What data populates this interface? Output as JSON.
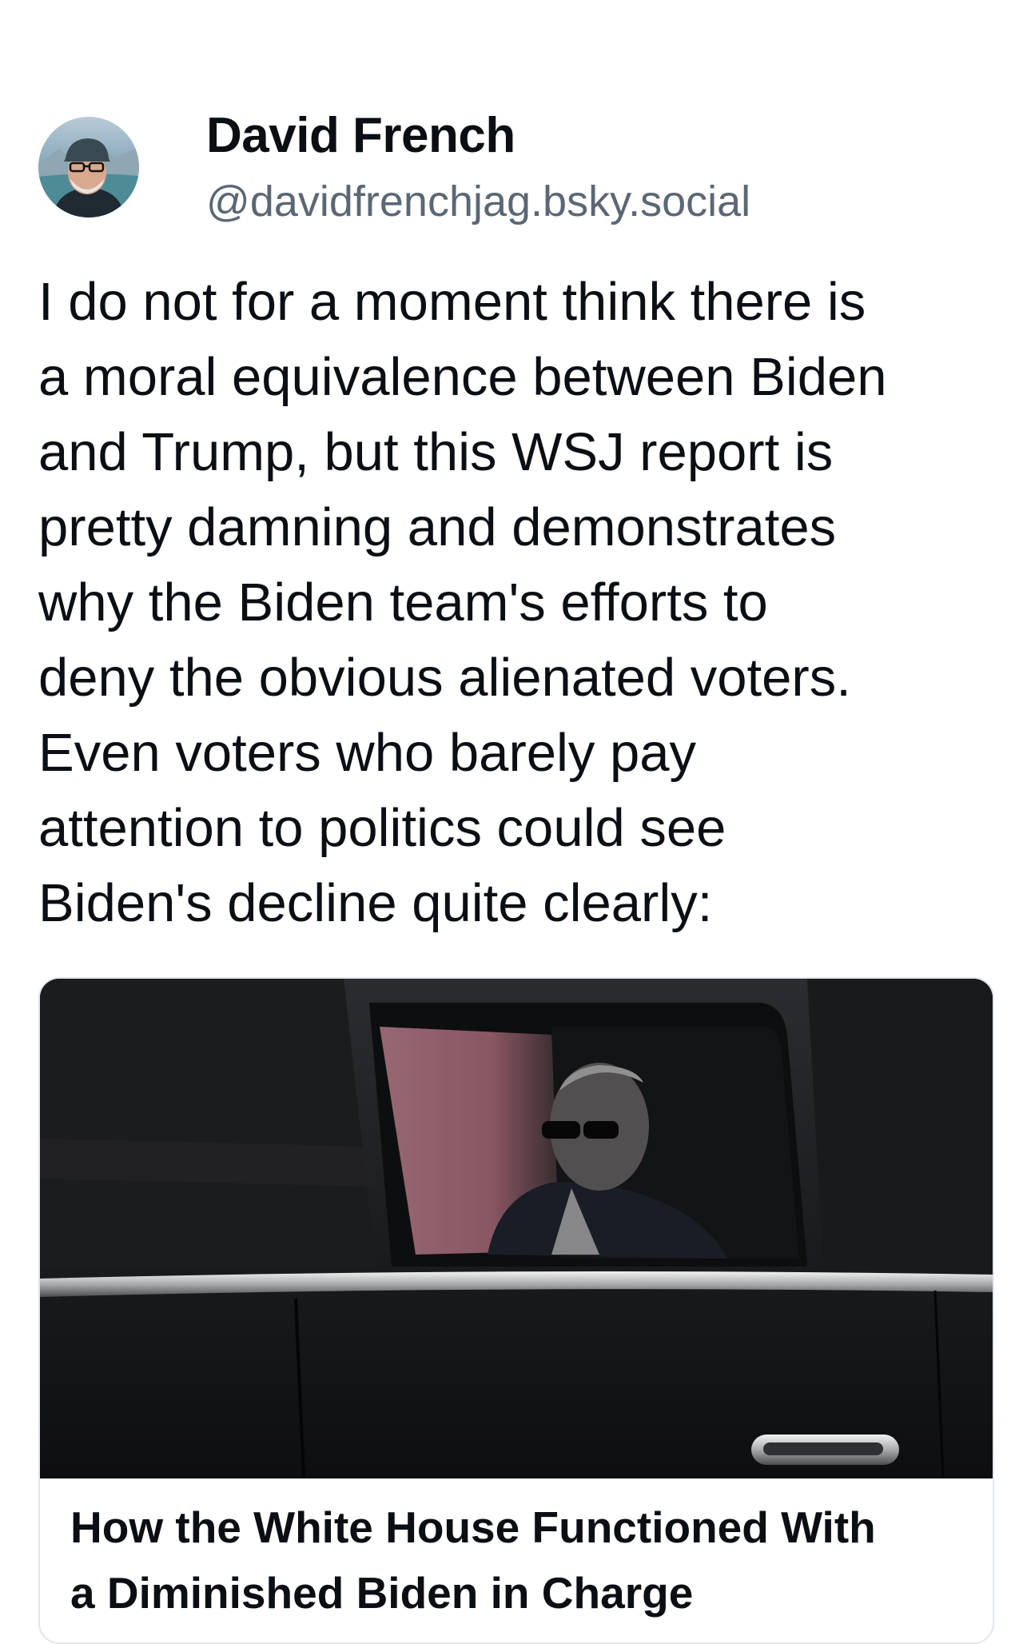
{
  "author": {
    "display_name": "David French",
    "handle": "@davidfrenchjag.bsky.social",
    "avatar_icon": "avatar-photo"
  },
  "post": {
    "text_lines": [
      "I do not for a moment think there is",
      "a moral equivalence between Biden",
      "and Trump, but this WSJ report is",
      "pretty damning and demonstrates",
      "why the Biden team's efforts to",
      "deny the obvious alienated voters.",
      "Even voters who barely pay",
      "attention to politics could see",
      "Biden's decline quite clearly:"
    ]
  },
  "link_card": {
    "image_icon": "car-window-photo",
    "title_lines": [
      "How the White House Functioned With",
      "a Diminished Biden in Charge"
    ]
  },
  "colors": {
    "text_primary": "#0b0f14",
    "text_secondary": "#5b6774",
    "card_border": "#e3e7eb"
  }
}
